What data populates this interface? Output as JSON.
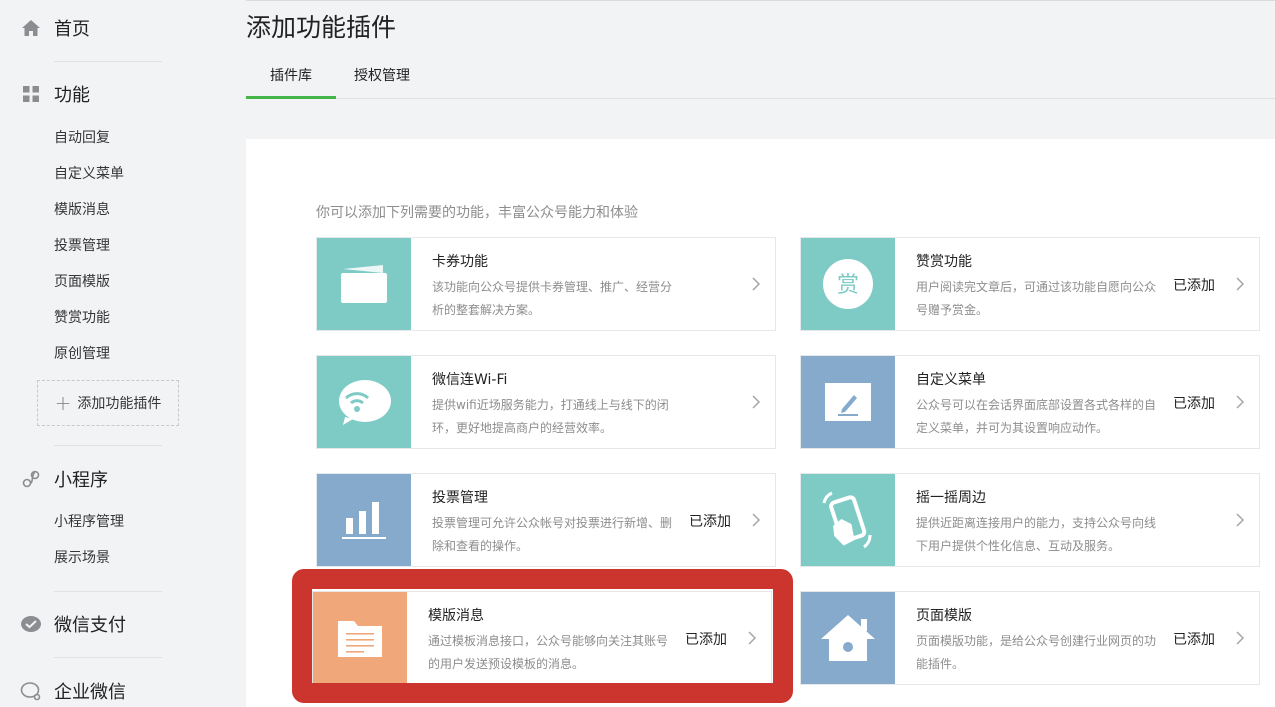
{
  "sidebar": {
    "home": {
      "label": "首页",
      "icon": "home-icon"
    },
    "features": {
      "label": "功能",
      "icon": "grid-icon",
      "items": [
        "自动回复",
        "自定义菜单",
        "模版消息",
        "投票管理",
        "页面模版",
        "赞赏功能",
        "原创管理"
      ],
      "add_label": "添加功能插件"
    },
    "miniprogram": {
      "label": "小程序",
      "icon": "link-icon",
      "items": [
        "小程序管理",
        "展示场景"
      ]
    },
    "pay": {
      "label": "微信支付",
      "icon": "wechat-pay-icon"
    },
    "enterprise": {
      "label": "企业微信",
      "icon": "enterprise-wechat-icon"
    }
  },
  "header": {
    "title": "添加功能插件",
    "tabs": [
      {
        "label": "插件库",
        "active": true
      },
      {
        "label": "授权管理",
        "active": false
      }
    ]
  },
  "main": {
    "intro": "你可以添加下列需要的功能，丰富公众号能力和体验",
    "plugins": [
      {
        "name": "卡券功能",
        "desc": "该功能向公众号提供卡券管理、推广、经营分析的整套解决方案。",
        "status": "",
        "icon": "card-icon",
        "color": "#7ecbc6"
      },
      {
        "name": "赞赏功能",
        "desc": "用户阅读完文章后，可通过该功能自愿向公众号赠予赏金。",
        "status": "已添加",
        "icon": "reward-icon",
        "icon_text": "赏",
        "color": "#7ecbc6"
      },
      {
        "name": "微信连Wi-Fi",
        "desc": "提供wifi近场服务能力，打通线上与线下的闭环，更好地提高商户的经营效率。",
        "status": "",
        "icon": "wifi-icon",
        "color": "#7ecbc6"
      },
      {
        "name": "自定义菜单",
        "desc": "公众号可以在会话界面底部设置各式各样的自定义菜单，并可为其设置响应动作。",
        "status": "已添加",
        "icon": "edit-icon",
        "color": "#86aacb"
      },
      {
        "name": "投票管理",
        "desc": "投票管理可允许公众帐号对投票进行新增、删除和查看的操作。",
        "status": "已添加",
        "icon": "bar-chart-icon",
        "color": "#86aacb"
      },
      {
        "name": "摇一摇周边",
        "desc": "提供近距离连接用户的能力，支持公众号向线下用户提供个性化信息、互动及服务。",
        "status": "",
        "icon": "shake-icon",
        "color": "#7ecbc6"
      },
      {
        "name": "模版消息",
        "desc": "通过模板消息接口，公众号能够向关注其账号的用户发送预设模板的消息。",
        "status": "已添加",
        "icon": "template-icon",
        "color": "#f0a87a"
      },
      {
        "name": "页面模版",
        "desc": "页面模版功能，是给公众号创建行业网页的功能插件。",
        "status": "已添加",
        "icon": "house-icon",
        "color": "#86aacb"
      }
    ]
  },
  "annotation": {
    "color": "#cc342e"
  }
}
